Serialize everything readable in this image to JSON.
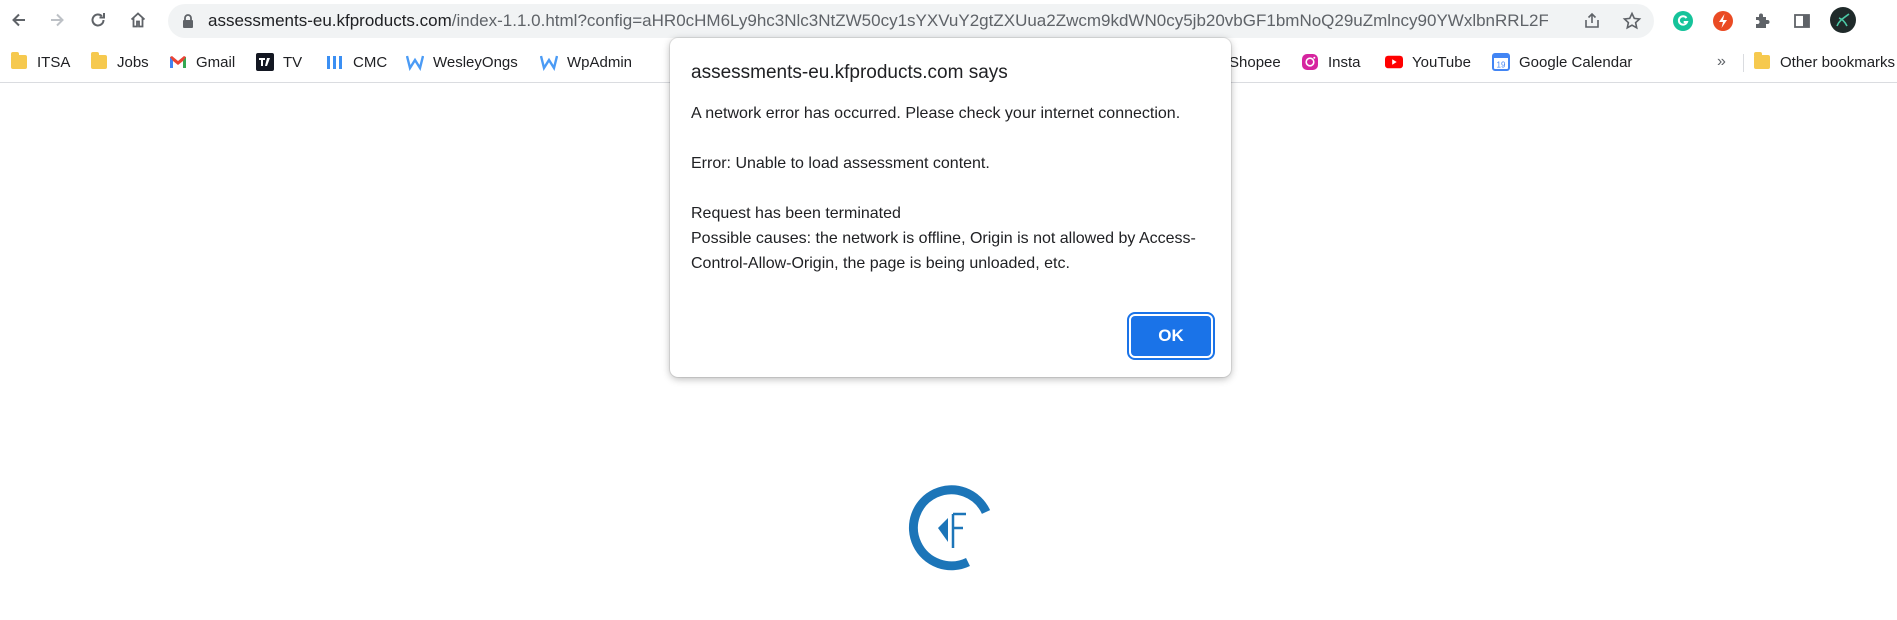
{
  "browser": {
    "url_host": "assessments-eu.kfproducts.com",
    "url_rest": "/index-1.1.0.html?config=aHR0cHM6Ly9hc3Nlc3NtZW50cy1sYXVuY2gtZXUua2Zwcm9kdWN0cy5jb20vbGF1bmNoQ29uZmlncy90YWxlbnRRL2F..."
  },
  "bookmarks": [
    {
      "label": "ITSA",
      "icon": "folder-icon"
    },
    {
      "label": "Jobs",
      "icon": "folder-icon"
    },
    {
      "label": "Gmail",
      "icon": "gmail-icon"
    },
    {
      "label": "TV",
      "icon": "tradingview-icon"
    },
    {
      "label": "CMC",
      "icon": "cmc-icon"
    },
    {
      "label": "WesleyOngs",
      "icon": "w-icon"
    },
    {
      "label": "WpAdmin",
      "icon": "w-icon"
    },
    {
      "label": "Shopee",
      "icon": "shopee-icon"
    },
    {
      "label": "Insta",
      "icon": "instagram-icon"
    },
    {
      "label": "YouTube",
      "icon": "youtube-icon"
    },
    {
      "label": "Google Calendar",
      "icon": "calendar-icon"
    },
    {
      "label": "Other bookmarks",
      "icon": "folder-icon"
    }
  ],
  "bookmarks_more": "»",
  "calendar_day": "19",
  "dialog": {
    "title": "assessments-eu.kfproducts.com says",
    "line1": "A network error has occurred. Please check your internet connection.",
    "line2": "Error: Unable to load assessment content.",
    "line3": "Request has been terminated",
    "line4": "Possible causes: the network is offline, Origin is not allowed by Access-Control-Allow-Origin, the page is being unloaded, etc.",
    "ok_label": "OK"
  },
  "colors": {
    "accent": "#1a73e8",
    "logo_blue": "#1c75b8"
  }
}
